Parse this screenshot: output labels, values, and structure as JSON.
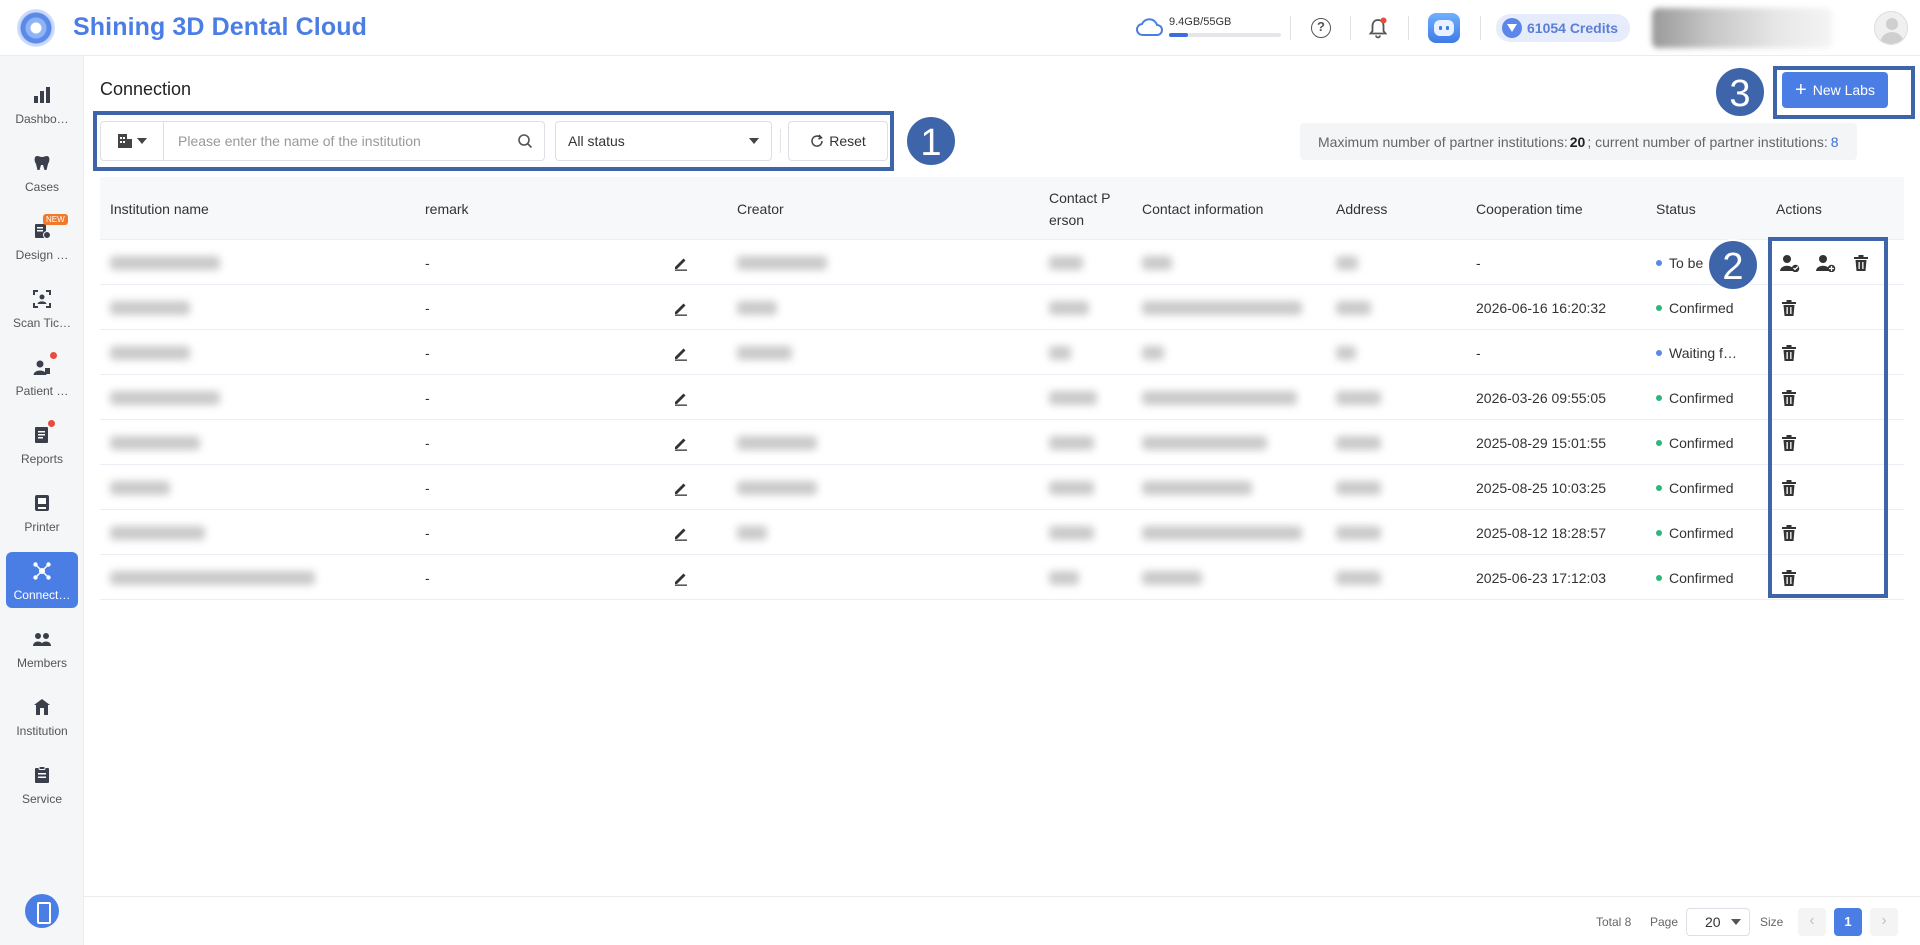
{
  "header": {
    "app_title": "Shining 3D Dental Cloud",
    "storage_text": "9.4GB/55GB",
    "storage_fraction": 0.17,
    "credits_text": "61054 Credits"
  },
  "sidebar": {
    "items": [
      {
        "label": "Dashbo…",
        "icon": "bar-chart-icon"
      },
      {
        "label": "Cases",
        "icon": "tooth-icon"
      },
      {
        "label": "Design …",
        "icon": "design-icon",
        "badge": "NEW"
      },
      {
        "label": "Scan Tic…",
        "icon": "scan-ticket-icon"
      },
      {
        "label": "Patient …",
        "icon": "patient-icon"
      },
      {
        "label": "Reports",
        "icon": "reports-icon"
      },
      {
        "label": "Printer",
        "icon": "printer-icon"
      },
      {
        "label": "Connect…",
        "icon": "connection-icon",
        "active": true
      },
      {
        "label": "Members",
        "icon": "members-icon"
      },
      {
        "label": "Institution",
        "icon": "institution-icon"
      },
      {
        "label": "Service",
        "icon": "service-icon"
      }
    ]
  },
  "main": {
    "title": "Connection",
    "search_placeholder": "Please enter the name of the institution",
    "status_select": "All status",
    "reset_label": "Reset",
    "new_labs_label": "New Labs",
    "limit": {
      "prefix": "Maximum number of partner institutions:",
      "max": "20",
      "middle": "; current number of partner institutions:",
      "current": "8"
    },
    "callouts": [
      "1",
      "2",
      "3"
    ]
  },
  "table": {
    "columns": [
      "Institution name",
      "remark",
      "Creator",
      "Contact P\nerson",
      "Contact information",
      "Address",
      "Cooperation time",
      "Status",
      "Actions"
    ],
    "rows": [
      {
        "remark": "-",
        "cooperation_time": "-",
        "status": "To be c",
        "status_color": "#5b86ea",
        "actions": [
          "accept-user-icon",
          "invite-user-icon",
          "trash-icon"
        ]
      },
      {
        "remark": "-",
        "cooperation_time": "2026-06-16 16:20:32",
        "status": "Confirmed",
        "status_color": "#2fb67c",
        "actions": [
          "trash-icon"
        ]
      },
      {
        "remark": "-",
        "cooperation_time": "-",
        "status": "Waiting f…",
        "status_color": "#5b86ea",
        "actions": [
          "trash-icon"
        ]
      },
      {
        "remark": "-",
        "cooperation_time": "2026-03-26 09:55:05",
        "status": "Confirmed",
        "status_color": "#2fb67c",
        "actions": [
          "trash-icon"
        ]
      },
      {
        "remark": "-",
        "cooperation_time": "2025-08-29 15:01:55",
        "status": "Confirmed",
        "status_color": "#2fb67c",
        "actions": [
          "trash-icon"
        ]
      },
      {
        "remark": "-",
        "cooperation_time": "2025-08-25 10:03:25",
        "status": "Confirmed",
        "status_color": "#2fb67c",
        "actions": [
          "trash-icon"
        ]
      },
      {
        "remark": "-",
        "cooperation_time": "2025-08-12 18:28:57",
        "status": "Confirmed",
        "status_color": "#2fb67c",
        "actions": [
          "trash-icon"
        ]
      },
      {
        "remark": "-",
        "cooperation_time": "2025-06-23 17:12:03",
        "status": "Confirmed",
        "status_color": "#2fb67c",
        "actions": [
          "trash-icon"
        ]
      }
    ]
  },
  "pagination": {
    "total": "Total 8",
    "page_label": "Page",
    "size_value": "20",
    "size_label": "Size",
    "current_page": "1",
    "prev": "‹",
    "next": "›"
  },
  "colors": {
    "accent": "#4b7ee5",
    "highlight_box": "#3e65aa",
    "confirmed": "#2fb67c",
    "pending": "#5b86ea"
  }
}
